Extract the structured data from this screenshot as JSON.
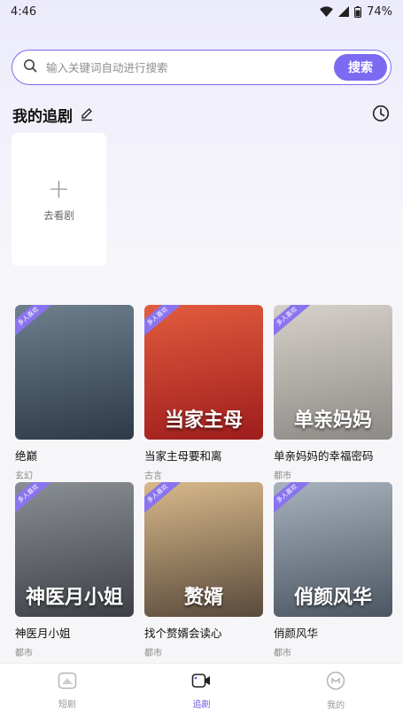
{
  "status_bar": {
    "time": "4:46",
    "battery": "74%"
  },
  "search": {
    "placeholder": "输入关键词自动进行搜索",
    "button_label": "搜索"
  },
  "my_follow": {
    "title": "我的追剧",
    "add_label": "去看剧"
  },
  "ribbon_text": "多人喜欢",
  "dramas": [
    {
      "title": "绝巅",
      "genre": "玄幻",
      "poster_text": "",
      "colors": [
        "#2d3a48",
        "#6e7f8e"
      ]
    },
    {
      "title": "当家主母要和离",
      "genre": "古言",
      "poster_text": "当家主母",
      "colors": [
        "#9e1c1c",
        "#e25c3e"
      ]
    },
    {
      "title": "单亲妈妈的幸福密码",
      "genre": "都市",
      "poster_text": "单亲妈妈",
      "colors": [
        "#8d8a86",
        "#d6d1c9"
      ]
    },
    {
      "title": "神医月小姐",
      "genre": "都市",
      "poster_text": "神医月小姐",
      "colors": [
        "#3d4147",
        "#8a8f94"
      ]
    },
    {
      "title": "找个赘婿会读心",
      "genre": "都市",
      "poster_text": "赘婿",
      "colors": [
        "#5a4a3c",
        "#d8b98a"
      ]
    },
    {
      "title": "俏颜风华",
      "genre": "都市",
      "poster_text": "俏颜风华",
      "colors": [
        "#4c5662",
        "#a7b2bd"
      ]
    }
  ],
  "tabs": [
    {
      "label": "短剧",
      "icon": "home-icon"
    },
    {
      "label": "追剧",
      "icon": "video-icon"
    },
    {
      "label": "我的",
      "icon": "profile-icon"
    }
  ],
  "active_tab": "追剧",
  "colors": {
    "accent": "#7c6af2"
  }
}
